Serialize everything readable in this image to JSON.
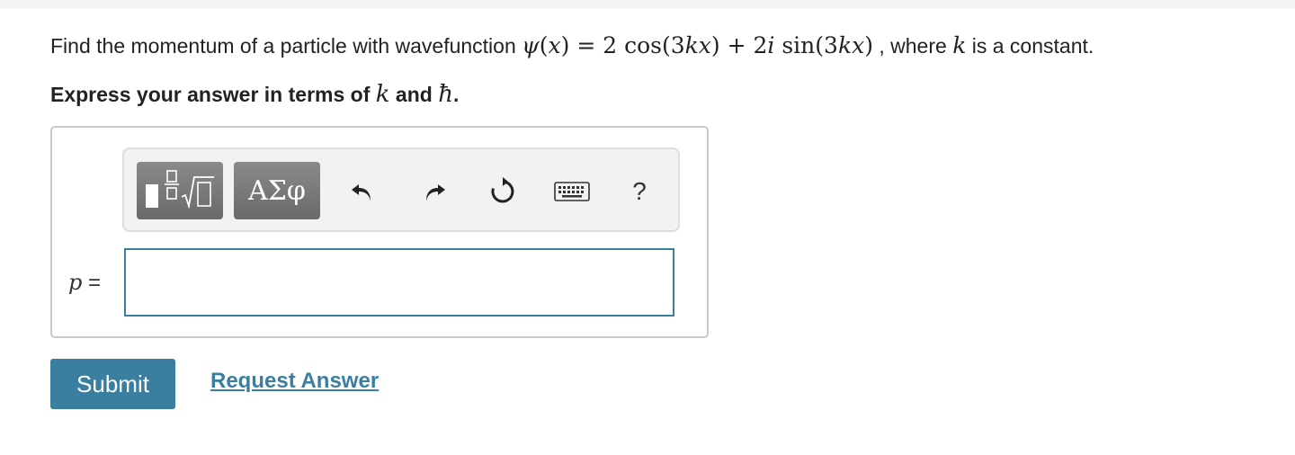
{
  "question": {
    "prefix": "Find the momentum of a particle with wavefunction ",
    "psi": "ψ",
    "x_var": "x",
    "equals": " = 2 cos(3",
    "k_var": "k",
    "x_var2": "x",
    "plus": ") + 2",
    "i_var": "i",
    "sin_open": " sin(3",
    "k_var2": "k",
    "x_var3": "x",
    "close": ")",
    "suffix_a": " , where ",
    "k_const": "k",
    "suffix_b": " is a constant."
  },
  "instruction": {
    "prefix": "Express your answer in terms of ",
    "k": "k",
    "and": " and ",
    "hbar": "ħ",
    "period": "."
  },
  "toolbar": {
    "greek_label": "ΑΣφ",
    "help_label": "?"
  },
  "answer": {
    "variable": "p",
    "equals": " =",
    "value": ""
  },
  "actions": {
    "submit_label": "Submit",
    "request_label": "Request Answer"
  },
  "colors": {
    "accent": "#3a7fa0",
    "toolbar_button": "#7a7a7a"
  },
  "icons": {
    "templates": "fraction-sqrt-icon",
    "undo": "undo-icon",
    "redo": "redo-icon",
    "reset": "reset-icon",
    "keyboard": "keyboard-icon"
  }
}
